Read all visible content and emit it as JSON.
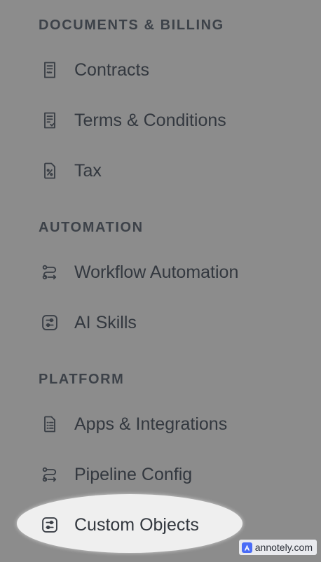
{
  "sections": [
    {
      "title": "DOCUMENTS & BILLING",
      "items": [
        {
          "label": "Contracts",
          "icon": "contract-document-icon"
        },
        {
          "label": "Terms & Conditions",
          "icon": "document-lines-icon"
        },
        {
          "label": "Tax",
          "icon": "percent-document-icon"
        }
      ]
    },
    {
      "title": "AUTOMATION",
      "items": [
        {
          "label": "Workflow Automation",
          "icon": "workflow-icon"
        },
        {
          "label": "AI Skills",
          "icon": "sliders-box-icon"
        }
      ]
    },
    {
      "title": "PLATFORM",
      "items": [
        {
          "label": "Apps & Integrations",
          "icon": "list-document-icon"
        },
        {
          "label": "Pipeline Config",
          "icon": "workflow-icon"
        },
        {
          "label": "Custom Objects",
          "icon": "sliders-box-icon"
        }
      ]
    }
  ],
  "watermark": {
    "text": "annotely.com"
  },
  "colors": {
    "background": "#8c8c8c",
    "text": "#33383f",
    "highlight": "#efefef"
  }
}
